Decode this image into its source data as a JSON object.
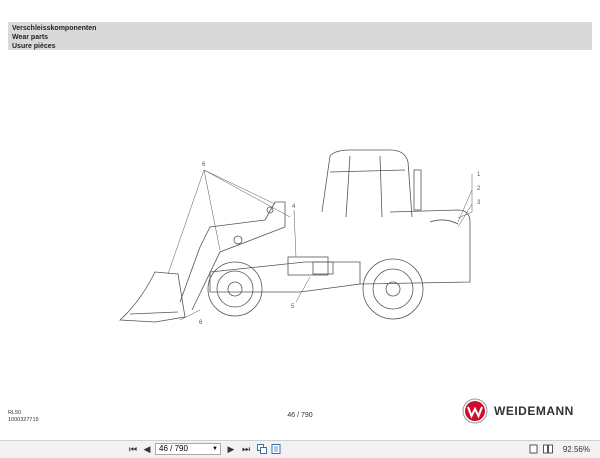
{
  "header": {
    "line1": "Verschleisskomponenten",
    "line2": "Wear parts",
    "line3": "Usure pièces"
  },
  "drawing": {
    "callouts": [
      "1",
      "2",
      "3",
      "4",
      "5",
      "6",
      "6"
    ]
  },
  "footer": {
    "model": "RL50",
    "doc_number": "1000327719",
    "page_label": "46 / 790"
  },
  "brand": {
    "name": "WEIDEMANN",
    "color": "#c8102e"
  },
  "toolbar": {
    "first_icon": "first-page-icon",
    "prev_icon": "previous-page-icon",
    "page_value": "46 / 790",
    "next_icon": "next-page-icon",
    "last_icon": "last-page-icon",
    "zoom": "92.56%"
  }
}
